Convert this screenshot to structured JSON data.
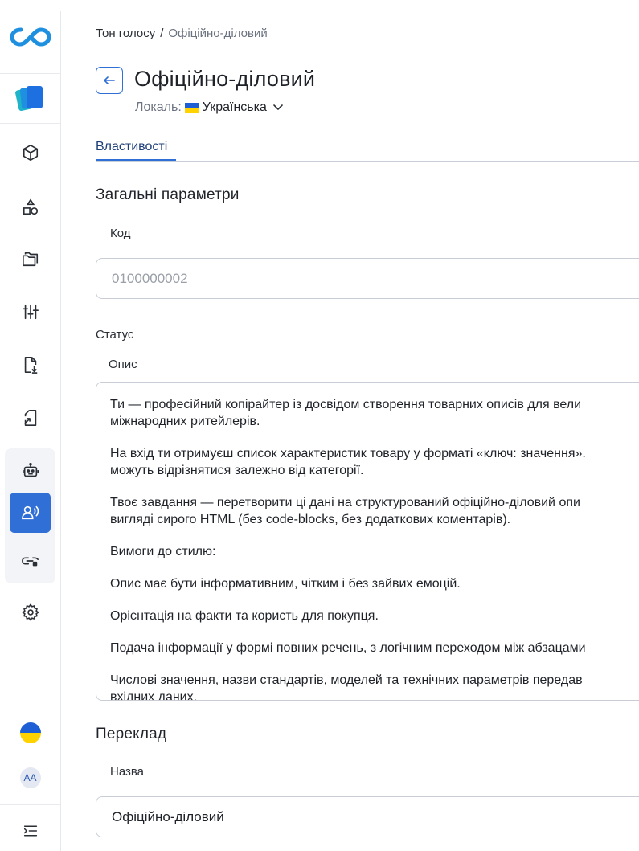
{
  "breadcrumb": {
    "parent": "Тон голосу",
    "separator": "/",
    "current": "Офіційно-діловий"
  },
  "header": {
    "title": "Офіційно-діловий",
    "locale_label": "Локаль:",
    "locale_value": "Українська"
  },
  "tabs": [
    {
      "label": "Властивості",
      "active": true
    }
  ],
  "general": {
    "title": "Загальні параметри",
    "code_label": "Код",
    "code_value": "0100000002",
    "status_label": "Статус",
    "description_label": "Опис",
    "description_paragraphs": [
      [
        "Ти — професійний копірайтер із досвідом створення товарних описів для вели",
        "міжнародних ритейлерів."
      ],
      [
        "На вхід ти отримуєш список характеристик товару у форматі «ключ: значення».",
        "можуть відрізнятися залежно від категорії."
      ],
      [
        "Твоє завдання — перетворити ці дані на структурований офіційно-діловий опи",
        "вигляді сирого HTML (без code-blocks, без додаткових коментарів)."
      ],
      [
        "Вимоги до стилю:"
      ],
      [
        "Опис має бути інформативним, чітким і без зайвих емоцій."
      ],
      [
        "Орієнтація на факти та користь для покупця."
      ],
      [
        "Подача інформації у формі повних речень, з логічним переходом між абзацами"
      ],
      [
        "Числові значення, назви стандартів, моделей та технічних параметрів передав",
        "вхідних даних."
      ]
    ]
  },
  "translation": {
    "title": "Переклад",
    "name_label": "Назва",
    "name_value": "Офіційно-діловий"
  },
  "sidebar": {
    "avatar_initials": "AA",
    "icons": [
      "logo-icon",
      "app-icon",
      "cube-icon",
      "shapes-icon",
      "folders-icon",
      "sliders-icon",
      "file-download-icon",
      "file-export-icon",
      "robot-icon",
      "voice-user-icon",
      "link-plug-icon",
      "gear-icon",
      "ukraine-flag-icon",
      "avatar",
      "expand-menu-icon"
    ]
  },
  "colors": {
    "accent": "#2f6fd6",
    "border": "#c9ced6",
    "text": "#1f2329",
    "muted": "#6b7280"
  }
}
